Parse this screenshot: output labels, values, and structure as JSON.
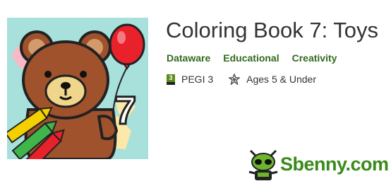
{
  "app": {
    "title": "Coloring Book 7: Toys",
    "icon_number": "7"
  },
  "tags": [
    "Dataware",
    "Educational",
    "Creativity"
  ],
  "ratings": {
    "pegi_label": "PEGI 3",
    "pegi_icon_number": "3",
    "ages_label": "Ages 5 & Under"
  },
  "watermark": {
    "text": "Sbenny.com"
  },
  "colors": {
    "tag_green": "#33691e",
    "title": "#333333",
    "icon_background": "#a8e0dc",
    "bear_brown": "#a0522d",
    "balloon_red": "#e8212b"
  },
  "icons": {
    "app_icon": "teddy-bear-with-balloon-and-crayons",
    "pegi": "pegi-rating-icon",
    "ages": "family-star-icon",
    "watermark": "android-alien-icon"
  }
}
